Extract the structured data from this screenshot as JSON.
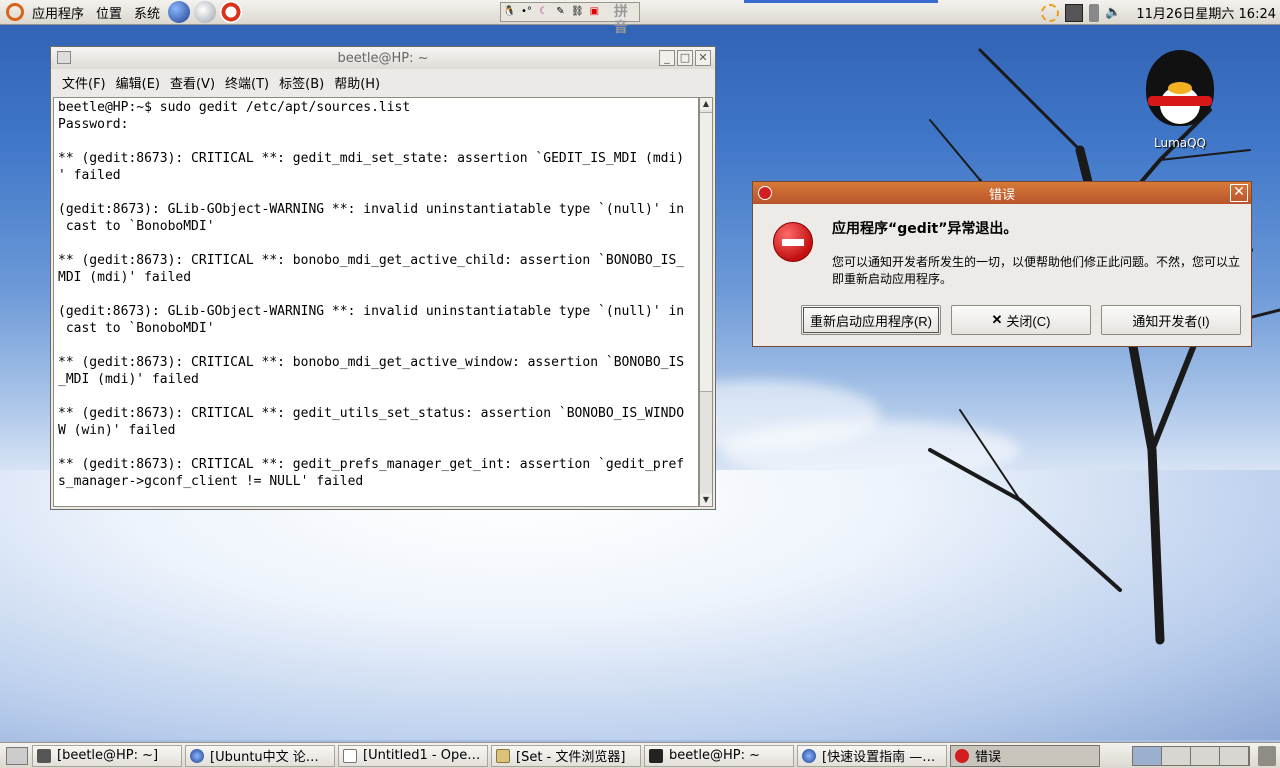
{
  "top_panel": {
    "menu": [
      "应用程序",
      "位置",
      "系统"
    ],
    "tray_mid_label": "拼音",
    "clock": "11月26日星期六 16:24"
  },
  "terminal": {
    "title": "beetle@HP: ~",
    "menu": [
      "文件(F)",
      "编辑(E)",
      "查看(V)",
      "终端(T)",
      "标签(B)",
      "帮助(H)"
    ],
    "output": "beetle@HP:~$ sudo gedit /etc/apt/sources.list\nPassword:\n\n** (gedit:8673): CRITICAL **: gedit_mdi_set_state: assertion `GEDIT_IS_MDI (mdi)\n' failed\n\n(gedit:8673): GLib-GObject-WARNING **: invalid uninstantiatable type `(null)' in\n cast to `BonoboMDI'\n\n** (gedit:8673): CRITICAL **: bonobo_mdi_get_active_child: assertion `BONOBO_IS_\nMDI (mdi)' failed\n\n(gedit:8673): GLib-GObject-WARNING **: invalid uninstantiatable type `(null)' in\n cast to `BonoboMDI'\n\n** (gedit:8673): CRITICAL **: bonobo_mdi_get_active_window: assertion `BONOBO_IS\n_MDI (mdi)' failed\n\n** (gedit:8673): CRITICAL **: gedit_utils_set_status: assertion `BONOBO_IS_WINDO\nW (win)' failed\n\n** (gedit:8673): CRITICAL **: gedit_prefs_manager_get_int: assertion `gedit_pref\ns_manager->gconf_client != NULL' failed"
  },
  "dialog": {
    "title": "错误",
    "heading": "应用程序“gedit”异常退出。",
    "message": "您可以通知开发者所发生的一切，以便帮助他们修正此问题。不然，您可以立即重新启动应用程序。",
    "buttons": {
      "restart": "重新启动应用程序(R)",
      "close": "关闭(C)",
      "notify": "通知开发者(I)"
    }
  },
  "desktop_icon": {
    "label": "LumaQQ"
  },
  "taskbar": {
    "tasks": [
      "[beetle@HP: ~]",
      "[Ubuntu中文 论…",
      "[Untitled1 - Ope…",
      "[Set - 文件浏览器]",
      "beetle@HP: ~",
      "[快速设置指南 —…",
      "错误"
    ]
  },
  "colors": {
    "dialog_title": "#b8542a",
    "error_red": "#d21e1e",
    "panel": "#dcd8d0"
  }
}
